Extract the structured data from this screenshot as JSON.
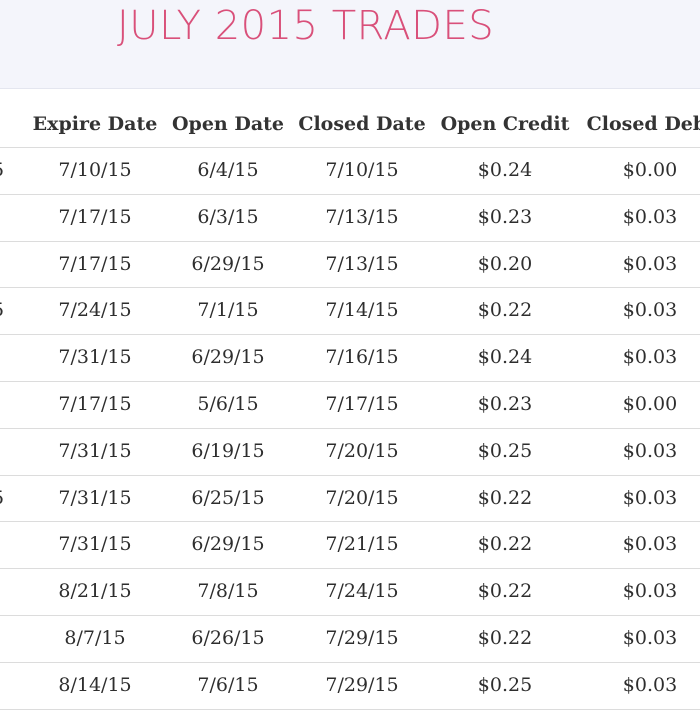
{
  "title": "JULY 2015 TRADES",
  "columns": [
    "Expire Date",
    "Open Date",
    "Closed Date",
    "Open Credit",
    "Closed Debi"
  ],
  "rows": [
    {
      "edge": "5",
      "cells": [
        "7/10/15",
        "6/4/15",
        "7/10/15",
        "$0.24",
        "$0.00"
      ]
    },
    {
      "edge": "",
      "cells": [
        "7/17/15",
        "6/3/15",
        "7/13/15",
        "$0.23",
        "$0.03"
      ]
    },
    {
      "edge": "",
      "cells": [
        "7/17/15",
        "6/29/15",
        "7/13/15",
        "$0.20",
        "$0.03"
      ]
    },
    {
      "edge": "5",
      "cells": [
        "7/24/15",
        "7/1/15",
        "7/14/15",
        "$0.22",
        "$0.03"
      ]
    },
    {
      "edge": "",
      "cells": [
        "7/31/15",
        "6/29/15",
        "7/16/15",
        "$0.24",
        "$0.03"
      ]
    },
    {
      "edge": "",
      "cells": [
        "7/17/15",
        "5/6/15",
        "7/17/15",
        "$0.23",
        "$0.00"
      ]
    },
    {
      "edge": "",
      "cells": [
        "7/31/15",
        "6/19/15",
        "7/20/15",
        "$0.25",
        "$0.03"
      ]
    },
    {
      "edge": "5",
      "cells": [
        "7/31/15",
        "6/25/15",
        "7/20/15",
        "$0.22",
        "$0.03"
      ]
    },
    {
      "edge": "",
      "cells": [
        "7/31/15",
        "6/29/15",
        "7/21/15",
        "$0.22",
        "$0.03"
      ]
    },
    {
      "edge": "",
      "cells": [
        "8/21/15",
        "7/8/15",
        "7/24/15",
        "$0.22",
        "$0.03"
      ]
    },
    {
      "edge": "",
      "cells": [
        "8/7/15",
        "6/26/15",
        "7/29/15",
        "$0.22",
        "$0.03"
      ]
    },
    {
      "edge": "",
      "cells": [
        "8/14/15",
        "7/6/15",
        "7/29/15",
        "$0.25",
        "$0.03"
      ]
    }
  ]
}
